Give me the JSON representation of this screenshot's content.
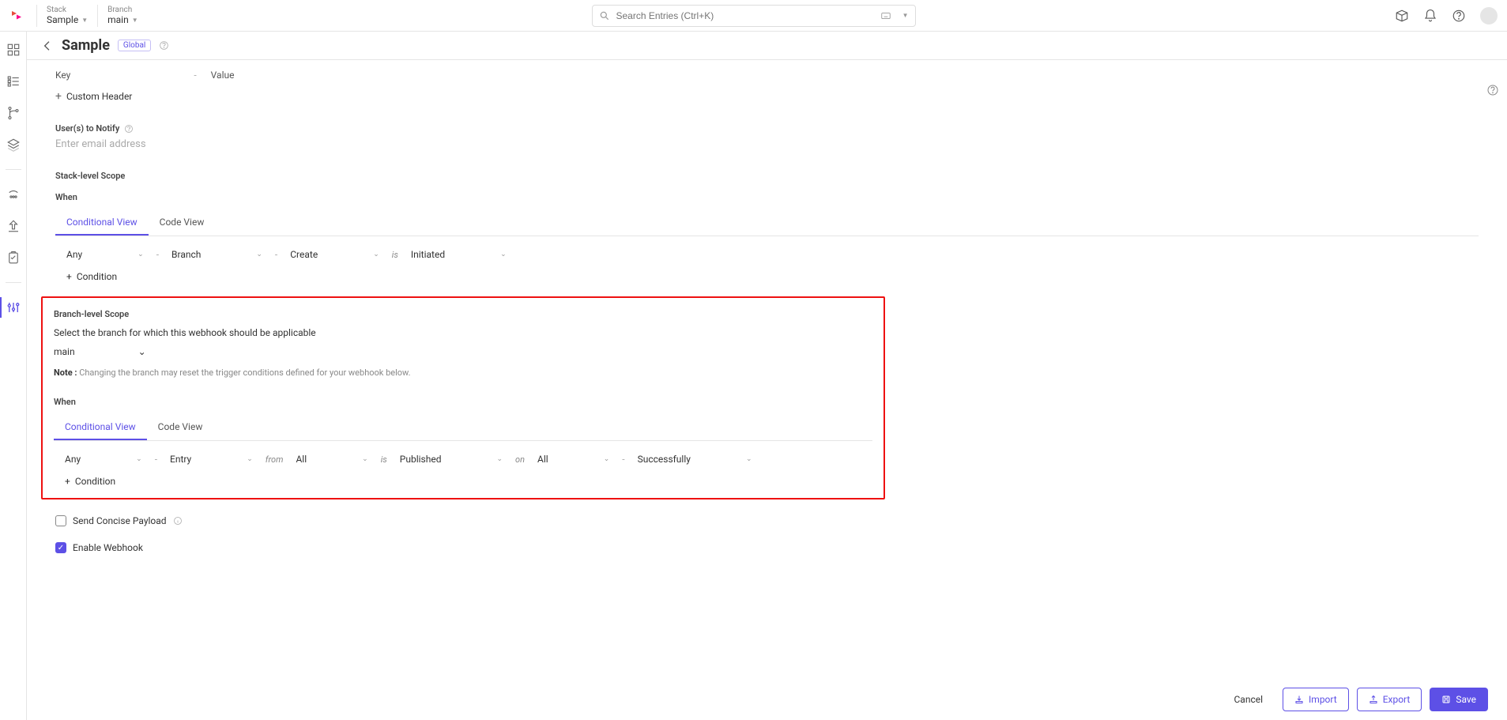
{
  "topbar": {
    "stack_label": "Stack",
    "stack_value": "Sample",
    "branch_label": "Branch",
    "branch_value": "main",
    "search_placeholder": "Search Entries (Ctrl+K)"
  },
  "header": {
    "title": "Sample",
    "badge": "Global"
  },
  "custom_headers": {
    "key_label": "Key",
    "value_label": "Value",
    "add_label": "Custom Header"
  },
  "users_notify": {
    "label": "User(s) to Notify",
    "placeholder": "Enter email address"
  },
  "stack_scope": {
    "title": "Stack-level Scope",
    "when": "When",
    "tabs": {
      "cond": "Conditional View",
      "code": "Code View"
    },
    "row": {
      "any": "Any",
      "subject": "Branch",
      "action": "Create",
      "is": "is",
      "status": "Initiated"
    },
    "add_condition": "Condition"
  },
  "branch_scope": {
    "title": "Branch-level Scope",
    "desc": "Select the branch for which this webhook should be applicable",
    "branch": "main",
    "note_prefix": "Note :",
    "note_text": "Changing the branch may reset the trigger conditions defined for your webhook below.",
    "when": "When",
    "tabs": {
      "cond": "Conditional View",
      "code": "Code View"
    },
    "row": {
      "any": "Any",
      "subject": "Entry",
      "from": "from",
      "from_val": "All",
      "is": "is",
      "status": "Published",
      "on": "on",
      "on_val": "All",
      "result": "Successfully"
    },
    "add_condition": "Condition"
  },
  "options": {
    "concise": "Send Concise Payload",
    "enable": "Enable Webhook"
  },
  "footer": {
    "cancel": "Cancel",
    "import": "Import",
    "export": "Export",
    "save": "Save"
  }
}
